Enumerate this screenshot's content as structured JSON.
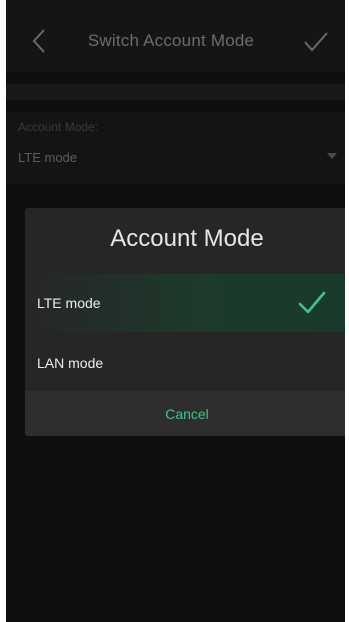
{
  "header": {
    "title": "Switch Account Mode",
    "back_icon": "chevron-left-icon",
    "confirm_icon": "check-icon"
  },
  "account_mode": {
    "label": "Account Mode:",
    "value": "LTE mode",
    "dropdown_icon": "caret-down-icon"
  },
  "dialog": {
    "title": "Account Mode",
    "options": [
      {
        "label": "LTE mode",
        "selected": true
      },
      {
        "label": "LAN mode",
        "selected": false
      }
    ],
    "cancel_label": "Cancel",
    "selected_icon": "check-icon"
  },
  "colors": {
    "accent": "#3fc587",
    "background": "#0f0f0f",
    "dialog_background": "#262626"
  }
}
